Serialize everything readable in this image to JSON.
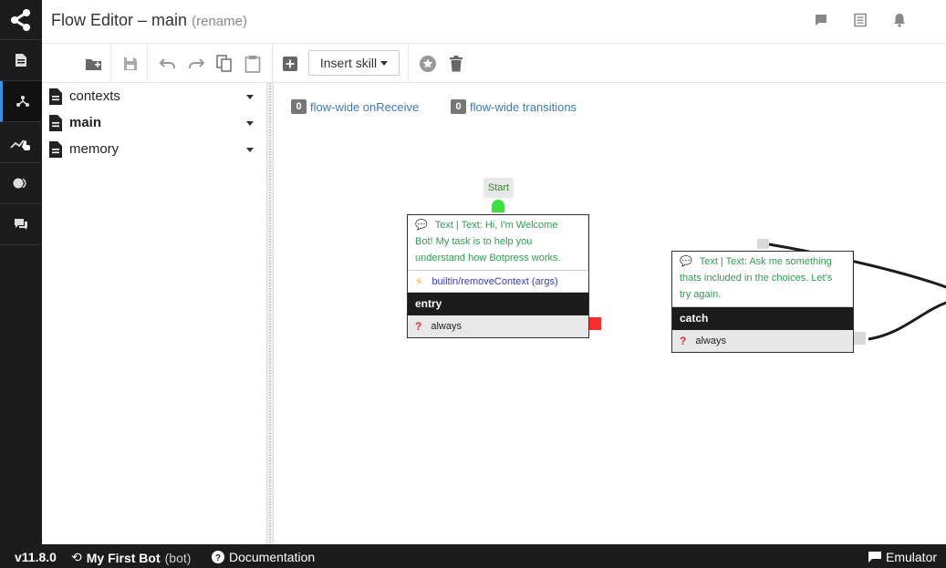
{
  "header": {
    "title": "Flow Editor – main",
    "rename_label": "(rename)",
    "icons": [
      "comment-icon",
      "list-icon",
      "bell-icon"
    ]
  },
  "rail": {
    "items": [
      "logo",
      "content-icon",
      "flows-icon",
      "analytics-icon",
      "toggle-icon",
      "chat-icon"
    ]
  },
  "toolbar": {
    "insert_skill_label": "Insert skill",
    "buttons": [
      "new-flow",
      "save",
      "undo",
      "redo",
      "copy",
      "paste",
      "add-node",
      "insert-skill",
      "set-start",
      "delete"
    ]
  },
  "flows": [
    {
      "label": "contexts",
      "bold": false
    },
    {
      "label": "main",
      "bold": true
    },
    {
      "label": "memory",
      "bold": false
    }
  ],
  "canvas": {
    "flow_wide_on_receive": {
      "count": "0",
      "label": "flow-wide onReceive"
    },
    "flow_wide_transitions": {
      "count": "0",
      "label": "flow-wide transitions"
    },
    "start_label": "Start",
    "entry_node": {
      "message": "Text | Text: Hi, I'm Welcome Bot! My task is to help you understand how Botpress works.",
      "action": "builtin/removeContext (args)",
      "name": "entry",
      "condition": "always"
    },
    "catch_node": {
      "message": "Text | Text: Ask me something thats included in the choices. Let's try again.",
      "name": "catch",
      "condition": "always"
    },
    "colors": {
      "start_port": "#3ce23c",
      "unlinked_port": "#ff2a2a",
      "link_line": "#1c1c1c"
    }
  },
  "footer": {
    "version": "v11.8.0",
    "bot_name": "My First Bot",
    "bot_id": "(bot)",
    "documentation_label": "Documentation",
    "emulator_label": "Emulator"
  }
}
